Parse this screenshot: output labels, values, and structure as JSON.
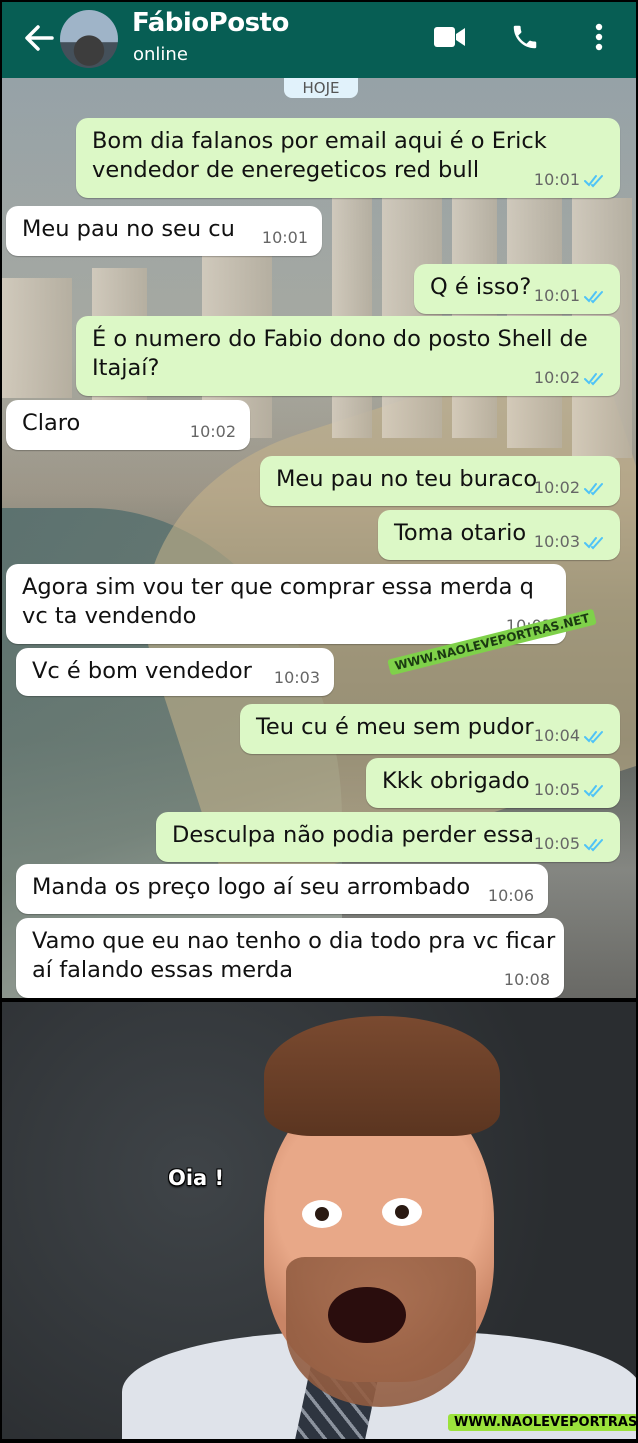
{
  "header": {
    "contact_name": "FábioPosto",
    "status": "online",
    "bg_color": "#075e54"
  },
  "chat": {
    "date_chip": "HOJE",
    "messages": [
      {
        "dir": "out",
        "text": "Bom dia falanos por email aqui é o Erick\nvendedor de eneregeticos red bull",
        "time": "10:01"
      },
      {
        "dir": "in",
        "text": "Meu pau no seu cu",
        "time": "10:01"
      },
      {
        "dir": "out",
        "text": "Q é isso?",
        "time": "10:01"
      },
      {
        "dir": "out",
        "text": "É o numero do Fabio dono do posto Shell de\nItajaí?",
        "time": "10:02"
      },
      {
        "dir": "in",
        "text": "Claro",
        "time": "10:02"
      },
      {
        "dir": "out",
        "text": "Meu pau no teu buraco",
        "time": "10:02"
      },
      {
        "dir": "out",
        "text": "Toma otario",
        "time": "10:03"
      },
      {
        "dir": "in",
        "text": "Agora sim vou ter que comprar essa merda q\nvc ta vendendo",
        "time": "10:03"
      },
      {
        "dir": "in",
        "text": "Vc é bom vendedor",
        "time": "10:03"
      },
      {
        "dir": "out",
        "text": "Teu cu é meu sem pudor",
        "time": "10:04"
      },
      {
        "dir": "out",
        "text": "Kkk obrigado",
        "time": "10:05"
      },
      {
        "dir": "out",
        "text": "Desculpa não podia perder essa",
        "time": "10:05"
      },
      {
        "dir": "in",
        "text": "Manda os preço logo aí seu arrombado",
        "time": "10:06"
      },
      {
        "dir": "in",
        "text": "Vamo que eu nao tenho o dia todo pra vc ficar\naí falando essas merda",
        "time": "10:08"
      }
    ],
    "watermark": "WWW.NAOLEVEPORTRAS.NET",
    "out_color": "#dcf8c6",
    "in_color": "#ffffff",
    "tick_color": "#4fc3f7"
  },
  "photo": {
    "caption": "Oia !",
    "watermark": "WWW.NAOLEVEPORTRAS.NET"
  }
}
